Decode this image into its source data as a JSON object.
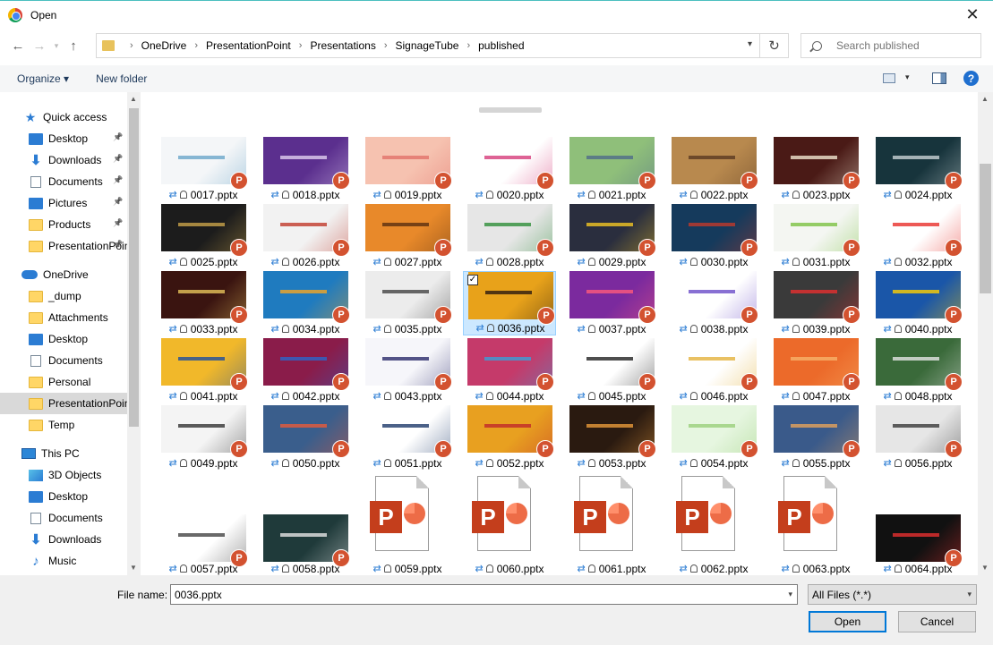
{
  "window": {
    "title": "Open"
  },
  "address": {
    "crumbs": [
      "OneDrive",
      "PresentationPoint",
      "Presentations",
      "SignageTube",
      "published"
    ]
  },
  "search": {
    "placeholder": "Search published"
  },
  "toolbar": {
    "organize": "Organize ▾",
    "new_folder": "New folder"
  },
  "sidebar": {
    "items": [
      {
        "label": "Quick access",
        "icon": "star",
        "pinned": false
      },
      {
        "label": "Desktop",
        "icon": "blue",
        "pinned": true
      },
      {
        "label": "Downloads",
        "icon": "down",
        "pinned": true
      },
      {
        "label": "Documents",
        "icon": "doc",
        "pinned": true
      },
      {
        "label": "Pictures",
        "icon": "blue",
        "pinned": true
      },
      {
        "label": "Products",
        "icon": "folder",
        "pinned": true
      },
      {
        "label": "PresentationPoint",
        "icon": "folder",
        "pinned": true
      },
      {
        "label": "OneDrive",
        "icon": "cloud",
        "pinned": false
      },
      {
        "label": "_dump",
        "icon": "folder",
        "pinned": false
      },
      {
        "label": "Attachments",
        "icon": "folder",
        "pinned": false
      },
      {
        "label": "Desktop",
        "icon": "blue",
        "pinned": false
      },
      {
        "label": "Documents",
        "icon": "doc",
        "pinned": false
      },
      {
        "label": "Personal",
        "icon": "folder",
        "pinned": false
      },
      {
        "label": "PresentationPoint",
        "icon": "folder",
        "pinned": false,
        "selected": true
      },
      {
        "label": "Temp",
        "icon": "folder",
        "pinned": false
      },
      {
        "label": "This PC",
        "icon": "pc",
        "pinned": false
      },
      {
        "label": "3D Objects",
        "icon": "cube",
        "pinned": false
      },
      {
        "label": "Desktop",
        "icon": "blue",
        "pinned": false
      },
      {
        "label": "Documents",
        "icon": "doc",
        "pinned": false
      },
      {
        "label": "Downloads",
        "icon": "down",
        "pinned": false
      },
      {
        "label": "Music",
        "icon": "music",
        "pinned": false
      }
    ]
  },
  "files": [
    {
      "name": "0017.pptx",
      "bg": "#f4f6f8",
      "accent": "#6aa6c9"
    },
    {
      "name": "0018.pptx",
      "bg": "#5b2f8e",
      "accent": "#e0d0f0"
    },
    {
      "name": "0019.pptx",
      "bg": "#f6c2b0",
      "accent": "#e2726a"
    },
    {
      "name": "0020.pptx",
      "bg": "#ffffff",
      "accent": "#d63c7a"
    },
    {
      "name": "0021.pptx",
      "bg": "#8fbf7a",
      "accent": "#4f6b8a"
    },
    {
      "name": "0022.pptx",
      "bg": "#b8894e",
      "accent": "#5a3a22"
    },
    {
      "name": "0023.pptx",
      "bg": "#4a1a16",
      "accent": "#f0e6d0"
    },
    {
      "name": "0024.pptx",
      "bg": "#17343c",
      "accent": "#c9d2d4"
    },
    {
      "name": "0025.pptx",
      "bg": "#1c1c1c",
      "accent": "#c8a24a"
    },
    {
      "name": "0026.pptx",
      "bg": "#f2f2f2",
      "accent": "#c0392b"
    },
    {
      "name": "0027.pptx",
      "bg": "#e8892a",
      "accent": "#5a3010"
    },
    {
      "name": "0028.pptx",
      "bg": "#e6e6e6",
      "accent": "#2f8f3a"
    },
    {
      "name": "0029.pptx",
      "bg": "#2a2e3e",
      "accent": "#f3c623"
    },
    {
      "name": "0030.pptx",
      "bg": "#153a5c",
      "accent": "#c0392b"
    },
    {
      "name": "0031.pptx",
      "bg": "#f4f6f2",
      "accent": "#7cc242"
    },
    {
      "name": "0032.pptx",
      "bg": "#ffffff",
      "accent": "#e8302a"
    },
    {
      "name": "0033.pptx",
      "bg": "#3a1410",
      "accent": "#e6c35a"
    },
    {
      "name": "0034.pptx",
      "bg": "#1f7bbf",
      "accent": "#f5a623"
    },
    {
      "name": "0035.pptx",
      "bg": "#ececec",
      "accent": "#444444"
    },
    {
      "name": "0036.pptx",
      "bg": "#e8a21a",
      "accent": "#2a1a10"
    },
    {
      "name": "0037.pptx",
      "bg": "#7b2a9e",
      "accent": "#ff5a7a"
    },
    {
      "name": "0038.pptx",
      "bg": "#ffffff",
      "accent": "#6a4cc8"
    },
    {
      "name": "0039.pptx",
      "bg": "#3a3a3a",
      "accent": "#e63030"
    },
    {
      "name": "0040.pptx",
      "bg": "#1a56a8",
      "accent": "#ffd000"
    },
    {
      "name": "0041.pptx",
      "bg": "#f1b82a",
      "accent": "#1e4d9c"
    },
    {
      "name": "0042.pptx",
      "bg": "#8a1c4a",
      "accent": "#2a66c9"
    },
    {
      "name": "0043.pptx",
      "bg": "#f6f6fa",
      "accent": "#2a2a6a"
    },
    {
      "name": "0044.pptx",
      "bg": "#c53a6a",
      "accent": "#3aa0d8"
    },
    {
      "name": "0045.pptx",
      "bg": "#ffffff",
      "accent": "#222222"
    },
    {
      "name": "0046.pptx",
      "bg": "#ffffff",
      "accent": "#e3b23c"
    },
    {
      "name": "0047.pptx",
      "bg": "#ec6a2a",
      "accent": "#f7b36a"
    },
    {
      "name": "0048.pptx",
      "bg": "#3a6a3a",
      "accent": "#e6e6e6"
    },
    {
      "name": "0049.pptx",
      "bg": "#f4f4f4",
      "accent": "#333333"
    },
    {
      "name": "0050.pptx",
      "bg": "#3a5e8c",
      "accent": "#e85a3a"
    },
    {
      "name": "0051.pptx",
      "bg": "#ffffff",
      "accent": "#1e3a6a"
    },
    {
      "name": "0052.pptx",
      "bg": "#e8a020",
      "accent": "#c0282a"
    },
    {
      "name": "0053.pptx",
      "bg": "#2a1a10",
      "accent": "#e89a3a"
    },
    {
      "name": "0054.pptx",
      "bg": "#e6f6e0",
      "accent": "#9ad07a"
    },
    {
      "name": "0055.pptx",
      "bg": "#3a5a8a",
      "accent": "#e6a25a"
    },
    {
      "name": "0056.pptx",
      "bg": "#e6e6e6",
      "accent": "#3a3a3a"
    },
    {
      "name": "0057.pptx",
      "bg": "#ffffff",
      "accent": "#444444"
    },
    {
      "name": "0058.pptx",
      "bg": "#1f3a3a",
      "accent": "#e6e6e6"
    },
    {
      "name": "0059.pptx",
      "bg": "",
      "accent": ""
    },
    {
      "name": "0060.pptx",
      "bg": "",
      "accent": ""
    },
    {
      "name": "0061.pptx",
      "bg": "",
      "accent": ""
    },
    {
      "name": "0062.pptx",
      "bg": "",
      "accent": ""
    },
    {
      "name": "0063.pptx",
      "bg": "",
      "accent": ""
    },
    {
      "name": "0064.pptx",
      "bg": "#111111",
      "accent": "#e63030"
    }
  ],
  "selected_file": "0036.pptx",
  "bottom": {
    "file_name_label": "File name:",
    "file_name_value": "0036.pptx",
    "file_type": "All Files (*.*)",
    "open_label": "Open",
    "cancel_label": "Cancel"
  },
  "colors": {
    "accent": "#0078d7",
    "selection": "#cce8ff",
    "ppt": "#d35230"
  }
}
